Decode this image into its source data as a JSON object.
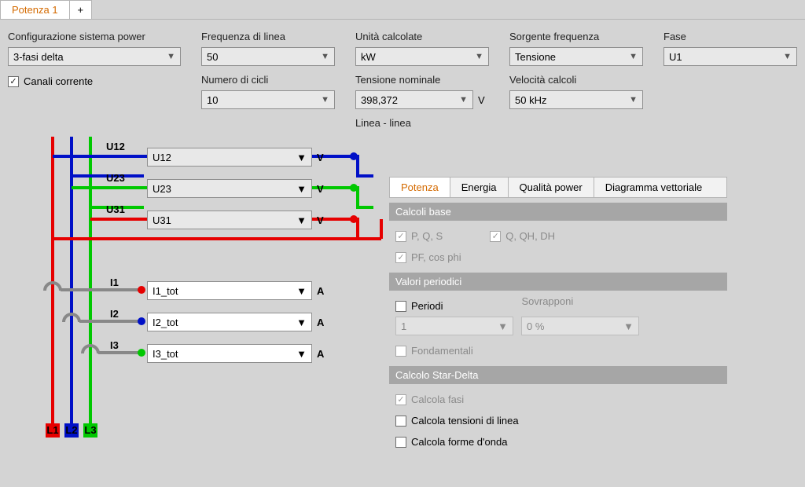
{
  "tabs": {
    "active": "Potenza 1",
    "add": "+"
  },
  "config": {
    "sys_label": "Configurazione sistema power",
    "sys_value": "3-fasi delta",
    "chan_current_label": "Canali corrente",
    "chan_current_checked": true,
    "freq_line_label": "Frequenza di linea",
    "freq_line_value": "50",
    "num_cycles_label": "Numero di cicli",
    "num_cycles_value": "10",
    "calc_units_label": "Unità calcolate",
    "calc_units_value": "kW",
    "nom_voltage_label": "Tensione nominale",
    "nom_voltage_value": "398,372",
    "nom_voltage_unit": "V",
    "line_line_label": "Linea - linea",
    "src_freq_label": "Sorgente frequenza",
    "src_freq_value": "Tensione",
    "calc_speed_label": "Velocità calcoli",
    "calc_speed_value": "50 kHz",
    "phase_label": "Fase",
    "phase_value": "U1"
  },
  "lines": {
    "L1": "L1",
    "L2": "L2",
    "L3": "L3"
  },
  "voltage": {
    "U12": {
      "lbl": "U12",
      "val": "U12",
      "unit": "V"
    },
    "U23": {
      "lbl": "U23",
      "val": "U23",
      "unit": "V"
    },
    "U31": {
      "lbl": "U31",
      "val": "U31",
      "unit": "V"
    }
  },
  "current": {
    "I1": {
      "lbl": "I1",
      "val": "I1_tot",
      "unit": "A"
    },
    "I2": {
      "lbl": "I2",
      "val": "I2_tot",
      "unit": "A"
    },
    "I3": {
      "lbl": "I3",
      "val": "I3_tot",
      "unit": "A"
    }
  },
  "panel": {
    "tabs": {
      "potenza": "Potenza",
      "energia": "Energia",
      "qualita": "Qualità power",
      "diagramma": "Diagramma vettoriale"
    },
    "calcoli_base": "Calcoli base",
    "pqs": "P, Q, S",
    "qqhdh": "Q, QH, DH",
    "pf": "PF, cos phi",
    "valori_periodici": "Valori periodici",
    "periodi": "Periodi",
    "periodi_val": "1",
    "sovrapponi": "Sovrapponi",
    "sovrapponi_val": "0 %",
    "fondamentali": "Fondamentali",
    "calcolo_star_delta": "Calcolo Star-Delta",
    "calcola_fasi": "Calcola fasi",
    "calcola_tensioni": "Calcola tensioni di linea",
    "calcola_forme": "Calcola forme d'onda"
  }
}
